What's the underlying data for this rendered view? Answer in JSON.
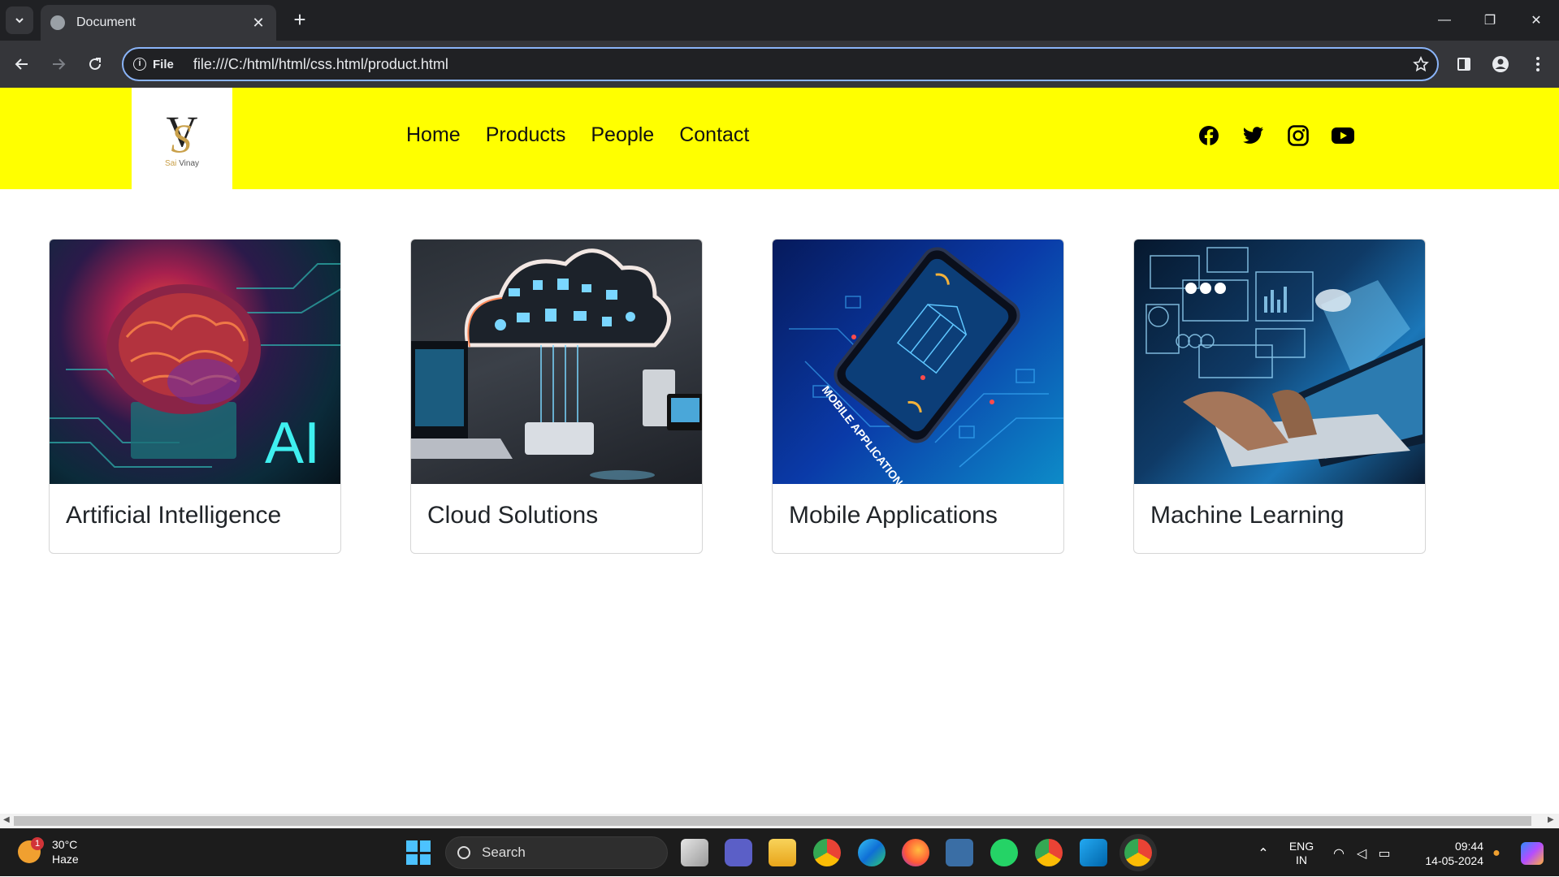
{
  "browser": {
    "tab_title": "Document",
    "tab_close": "✕",
    "new_tab": "+",
    "origin_chip": "File",
    "url": "file:///C:/html/html/css.html/product.html",
    "window_minimize": "—",
    "window_restore": "❐",
    "window_close": "✕"
  },
  "site": {
    "brand_mark": "V",
    "brand_mark_accent": "S",
    "brand_name_first": "Sai",
    "brand_name_last": "Vinay",
    "nav": [
      "Home",
      "Products",
      "People",
      "Contact"
    ],
    "social": [
      "facebook",
      "twitter",
      "instagram",
      "youtube"
    ],
    "header_color": "#ffff00"
  },
  "cards": [
    {
      "title": "Artificial Intelligence",
      "image": "ai-brain-circuit",
      "image_text": "AI"
    },
    {
      "title": "Cloud Solutions",
      "image": "cloud-laptop-devices"
    },
    {
      "title": "Mobile Applications",
      "image": "smartphone-circuit",
      "image_text": "MOBILE APPLICATION"
    },
    {
      "title": "Machine Learning",
      "image": "robot-hand-laptop"
    }
  ],
  "taskbar": {
    "weather_temp": "30°C",
    "weather_desc": "Haze",
    "weather_badge": "1",
    "search_placeholder": "Search",
    "lang_top": "ENG",
    "lang_bottom": "IN",
    "time": "09:44",
    "date": "14-05-2024"
  }
}
